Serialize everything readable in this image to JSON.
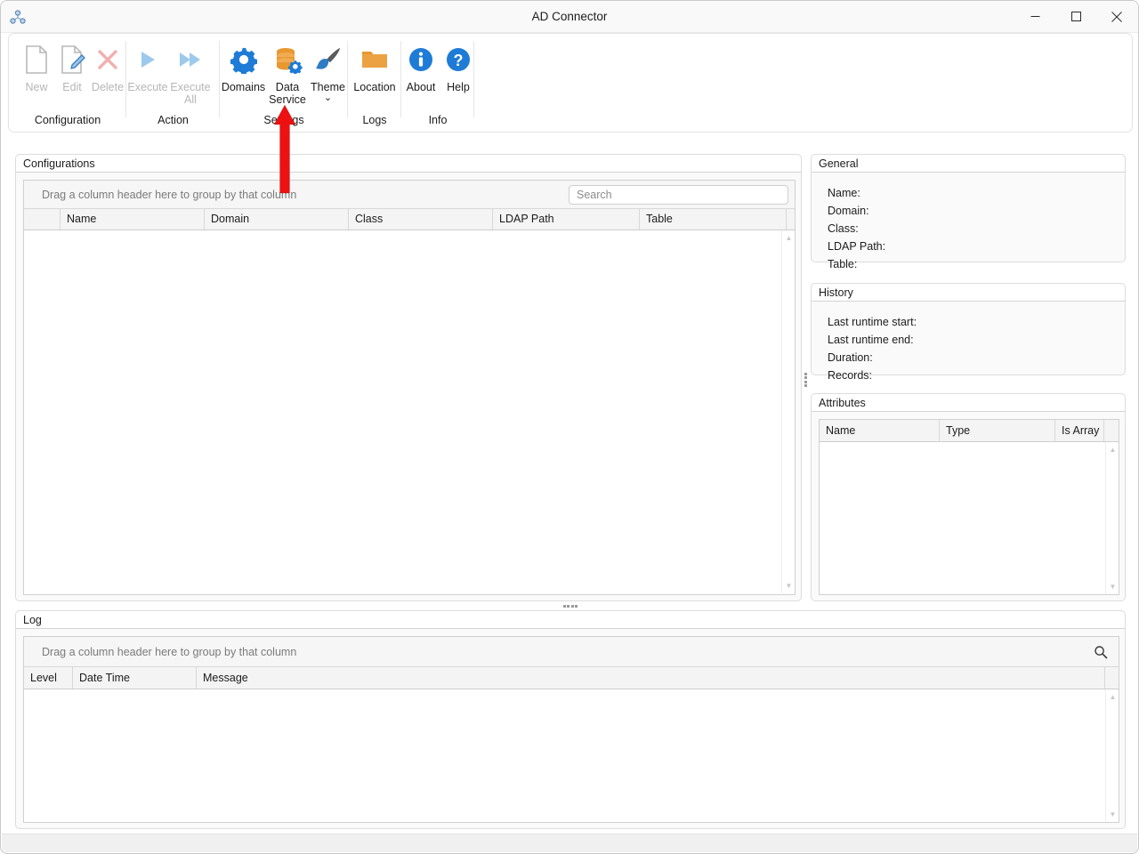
{
  "window": {
    "title": "AD Connector",
    "app_icon": "network-nodes-icon",
    "controls": {
      "minimize": "minimize-icon",
      "maximize": "maximize-icon",
      "close": "close-icon"
    }
  },
  "ribbon": {
    "groups": [
      {
        "label": "Configuration",
        "buttons": [
          {
            "label": "New",
            "icon": "new-document-icon",
            "enabled": false
          },
          {
            "label": "Edit",
            "icon": "edit-document-icon",
            "enabled": false
          },
          {
            "label": "Delete",
            "icon": "delete-x-icon",
            "enabled": false
          }
        ]
      },
      {
        "label": "Action",
        "buttons": [
          {
            "label": "Execute",
            "icon": "play-icon",
            "enabled": false
          },
          {
            "label": "Execute\nAll",
            "icon": "play-all-icon",
            "enabled": false
          }
        ]
      },
      {
        "label": "Settings",
        "buttons": [
          {
            "label": "Domains",
            "icon": "gear-icon",
            "enabled": true
          },
          {
            "label": "Data\nService",
            "icon": "database-gear-icon",
            "enabled": true
          },
          {
            "label": "Theme",
            "icon": "paintbrush-icon",
            "enabled": true,
            "dropdown": "chevron-down-icon"
          }
        ]
      },
      {
        "label": "Logs",
        "buttons": [
          {
            "label": "Location",
            "icon": "folder-icon",
            "enabled": true
          }
        ]
      },
      {
        "label": "Info",
        "buttons": [
          {
            "label": "About",
            "icon": "info-circle-icon",
            "enabled": true
          },
          {
            "label": "Help",
            "icon": "question-circle-icon",
            "enabled": true
          }
        ]
      }
    ]
  },
  "configurations_panel": {
    "title": "Configurations",
    "group_hint": "Drag a column header here to group by that column",
    "search": {
      "value": "",
      "placeholder": "Search"
    },
    "columns": [
      "",
      "Name",
      "Domain",
      "Class",
      "LDAP Path",
      "Table",
      ""
    ],
    "rows": []
  },
  "general_panel": {
    "title": "General",
    "fields": [
      {
        "label": "Name:",
        "value": ""
      },
      {
        "label": "Domain:",
        "value": ""
      },
      {
        "label": "Class:",
        "value": ""
      },
      {
        "label": "LDAP Path:",
        "value": ""
      },
      {
        "label": "Table:",
        "value": ""
      }
    ]
  },
  "history_panel": {
    "title": "History",
    "fields": [
      {
        "label": "Last runtime start:",
        "value": ""
      },
      {
        "label": "Last runtime end:",
        "value": ""
      },
      {
        "label": "Duration:",
        "value": ""
      },
      {
        "label": "Records:",
        "value": ""
      }
    ]
  },
  "attributes_panel": {
    "title": "Attributes",
    "columns": [
      "Name",
      "Type",
      "Is Array",
      ""
    ],
    "rows": []
  },
  "log_panel": {
    "title": "Log",
    "group_hint": "Drag a column header here to group by that column",
    "search_icon": "search-icon",
    "columns": [
      "Level",
      "Date Time",
      "Message",
      ""
    ],
    "rows": []
  },
  "annotation": {
    "type": "arrow-up",
    "color": "#EE1111",
    "points_to": "Data Service"
  },
  "colors": {
    "accent_blue": "#1E7BD6",
    "orange": "#E8982F",
    "window_bg": "#FFFFFF",
    "panel_bg": "#FAFAFA",
    "header_bg": "#F4F4F4",
    "border": "#DCDCDC",
    "disabled_text": "#B6B6B6"
  },
  "statusbar": {
    "text": ""
  }
}
